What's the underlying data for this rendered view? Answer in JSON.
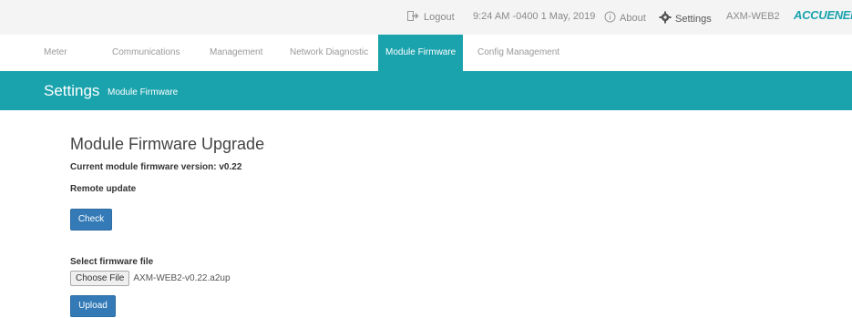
{
  "topbar": {
    "logout_label": "Logout",
    "datetime": "9:24 AM -0400 1 May, 2019",
    "about_label": "About",
    "settings_label": "Settings",
    "device_name": "AXM-WEB2",
    "brand": "ACCUENERGY"
  },
  "nav": {
    "tabs": [
      {
        "label": "Meter"
      },
      {
        "label": "Communications"
      },
      {
        "label": "Management"
      },
      {
        "label": "Network Diagnostic"
      },
      {
        "label": "Module Firmware",
        "active": true
      },
      {
        "label": "Config Management"
      }
    ]
  },
  "band": {
    "title": "Settings",
    "subtitle": "Module Firmware"
  },
  "main": {
    "heading": "Module Firmware Upgrade",
    "current_version": "Current module firmware version: v0.22",
    "remote_label": "Remote update",
    "check_label": "Check",
    "select_label": "Select firmware file",
    "choose_label": "Choose File",
    "file_name": "AXM-WEB2-v0.22.a2up",
    "upload_label": "Upload"
  },
  "colors": {
    "accent": "#1aa3ad",
    "button": "#337ab7"
  }
}
